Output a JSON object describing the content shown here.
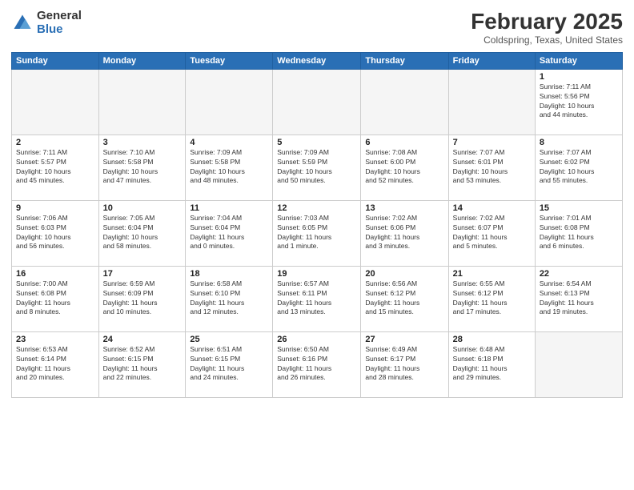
{
  "logo": {
    "general": "General",
    "blue": "Blue"
  },
  "header": {
    "month": "February 2025",
    "location": "Coldspring, Texas, United States"
  },
  "weekdays": [
    "Sunday",
    "Monday",
    "Tuesday",
    "Wednesday",
    "Thursday",
    "Friday",
    "Saturday"
  ],
  "weeks": [
    [
      {
        "day": "",
        "info": ""
      },
      {
        "day": "",
        "info": ""
      },
      {
        "day": "",
        "info": ""
      },
      {
        "day": "",
        "info": ""
      },
      {
        "day": "",
        "info": ""
      },
      {
        "day": "",
        "info": ""
      },
      {
        "day": "1",
        "info": "Sunrise: 7:11 AM\nSunset: 5:56 PM\nDaylight: 10 hours\nand 44 minutes."
      }
    ],
    [
      {
        "day": "2",
        "info": "Sunrise: 7:11 AM\nSunset: 5:57 PM\nDaylight: 10 hours\nand 45 minutes."
      },
      {
        "day": "3",
        "info": "Sunrise: 7:10 AM\nSunset: 5:58 PM\nDaylight: 10 hours\nand 47 minutes."
      },
      {
        "day": "4",
        "info": "Sunrise: 7:09 AM\nSunset: 5:58 PM\nDaylight: 10 hours\nand 48 minutes."
      },
      {
        "day": "5",
        "info": "Sunrise: 7:09 AM\nSunset: 5:59 PM\nDaylight: 10 hours\nand 50 minutes."
      },
      {
        "day": "6",
        "info": "Sunrise: 7:08 AM\nSunset: 6:00 PM\nDaylight: 10 hours\nand 52 minutes."
      },
      {
        "day": "7",
        "info": "Sunrise: 7:07 AM\nSunset: 6:01 PM\nDaylight: 10 hours\nand 53 minutes."
      },
      {
        "day": "8",
        "info": "Sunrise: 7:07 AM\nSunset: 6:02 PM\nDaylight: 10 hours\nand 55 minutes."
      }
    ],
    [
      {
        "day": "9",
        "info": "Sunrise: 7:06 AM\nSunset: 6:03 PM\nDaylight: 10 hours\nand 56 minutes."
      },
      {
        "day": "10",
        "info": "Sunrise: 7:05 AM\nSunset: 6:04 PM\nDaylight: 10 hours\nand 58 minutes."
      },
      {
        "day": "11",
        "info": "Sunrise: 7:04 AM\nSunset: 6:04 PM\nDaylight: 11 hours\nand 0 minutes."
      },
      {
        "day": "12",
        "info": "Sunrise: 7:03 AM\nSunset: 6:05 PM\nDaylight: 11 hours\nand 1 minute."
      },
      {
        "day": "13",
        "info": "Sunrise: 7:02 AM\nSunset: 6:06 PM\nDaylight: 11 hours\nand 3 minutes."
      },
      {
        "day": "14",
        "info": "Sunrise: 7:02 AM\nSunset: 6:07 PM\nDaylight: 11 hours\nand 5 minutes."
      },
      {
        "day": "15",
        "info": "Sunrise: 7:01 AM\nSunset: 6:08 PM\nDaylight: 11 hours\nand 6 minutes."
      }
    ],
    [
      {
        "day": "16",
        "info": "Sunrise: 7:00 AM\nSunset: 6:08 PM\nDaylight: 11 hours\nand 8 minutes."
      },
      {
        "day": "17",
        "info": "Sunrise: 6:59 AM\nSunset: 6:09 PM\nDaylight: 11 hours\nand 10 minutes."
      },
      {
        "day": "18",
        "info": "Sunrise: 6:58 AM\nSunset: 6:10 PM\nDaylight: 11 hours\nand 12 minutes."
      },
      {
        "day": "19",
        "info": "Sunrise: 6:57 AM\nSunset: 6:11 PM\nDaylight: 11 hours\nand 13 minutes."
      },
      {
        "day": "20",
        "info": "Sunrise: 6:56 AM\nSunset: 6:12 PM\nDaylight: 11 hours\nand 15 minutes."
      },
      {
        "day": "21",
        "info": "Sunrise: 6:55 AM\nSunset: 6:12 PM\nDaylight: 11 hours\nand 17 minutes."
      },
      {
        "day": "22",
        "info": "Sunrise: 6:54 AM\nSunset: 6:13 PM\nDaylight: 11 hours\nand 19 minutes."
      }
    ],
    [
      {
        "day": "23",
        "info": "Sunrise: 6:53 AM\nSunset: 6:14 PM\nDaylight: 11 hours\nand 20 minutes."
      },
      {
        "day": "24",
        "info": "Sunrise: 6:52 AM\nSunset: 6:15 PM\nDaylight: 11 hours\nand 22 minutes."
      },
      {
        "day": "25",
        "info": "Sunrise: 6:51 AM\nSunset: 6:15 PM\nDaylight: 11 hours\nand 24 minutes."
      },
      {
        "day": "26",
        "info": "Sunrise: 6:50 AM\nSunset: 6:16 PM\nDaylight: 11 hours\nand 26 minutes."
      },
      {
        "day": "27",
        "info": "Sunrise: 6:49 AM\nSunset: 6:17 PM\nDaylight: 11 hours\nand 28 minutes."
      },
      {
        "day": "28",
        "info": "Sunrise: 6:48 AM\nSunset: 6:18 PM\nDaylight: 11 hours\nand 29 minutes."
      },
      {
        "day": "",
        "info": ""
      }
    ]
  ]
}
